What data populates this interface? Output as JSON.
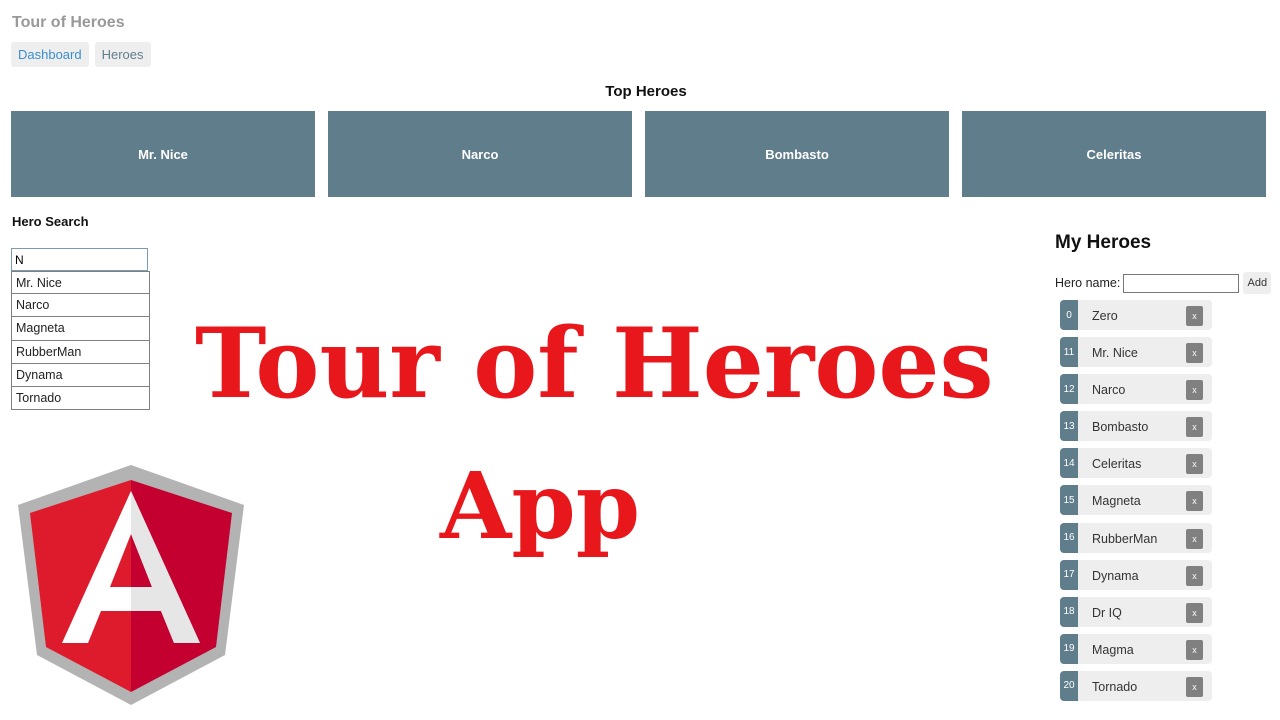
{
  "app": {
    "title": "Tour of Heroes"
  },
  "nav": {
    "dashboard": "Dashboard",
    "heroes": "Heroes"
  },
  "dashboard": {
    "heading": "Top Heroes",
    "top_heroes": [
      "Mr. Nice",
      "Narco",
      "Bombasto",
      "Celeritas"
    ]
  },
  "search": {
    "heading": "Hero Search",
    "value": "N",
    "results": [
      "Mr. Nice",
      "Narco",
      "Magneta",
      "RubberMan",
      "Dynama",
      "Tornado"
    ]
  },
  "overlay": {
    "title": "Tour of Heroes",
    "subtitle": "App"
  },
  "my_heroes": {
    "heading": "My Heroes",
    "hero_name_label": "Hero name:",
    "hero_name_value": "",
    "add_label": "Add",
    "delete_label": "x",
    "heroes": [
      {
        "id": "0",
        "name": "Zero"
      },
      {
        "id": "11",
        "name": "Mr. Nice"
      },
      {
        "id": "12",
        "name": "Narco"
      },
      {
        "id": "13",
        "name": "Bombasto"
      },
      {
        "id": "14",
        "name": "Celeritas"
      },
      {
        "id": "15",
        "name": "Magneta"
      },
      {
        "id": "16",
        "name": "RubberMan"
      },
      {
        "id": "17",
        "name": "Dynama"
      },
      {
        "id": "18",
        "name": "Dr IQ"
      },
      {
        "id": "19",
        "name": "Magma"
      },
      {
        "id": "20",
        "name": "Tornado"
      }
    ]
  },
  "logo": {
    "icon": "angular-logo-icon"
  },
  "colors": {
    "card": "#607d8b",
    "overlay_text": "#e8171c",
    "active_link": "#3a8fcf",
    "logo_red_left": "#dd1b2c",
    "logo_red_right": "#c3002f",
    "logo_border": "#b3b3b3"
  }
}
